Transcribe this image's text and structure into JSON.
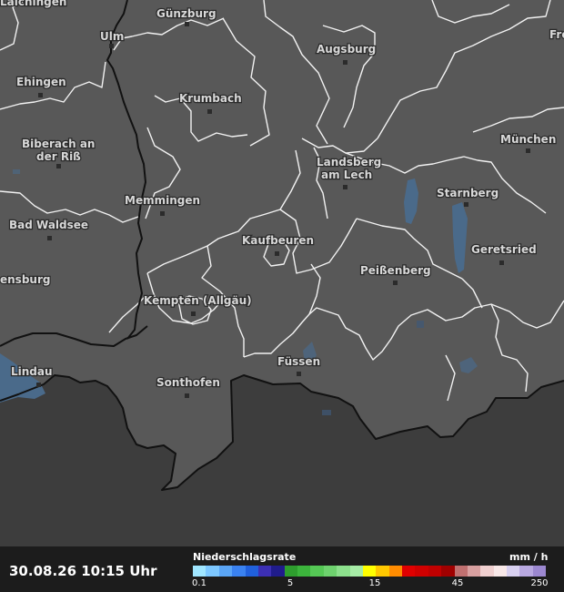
{
  "map": {
    "cities": [
      {
        "id": "laichingen",
        "label": "Laichingen"
      },
      {
        "id": "guenzburg",
        "label": "Günzburg"
      },
      {
        "id": "ulm",
        "label": "Ulm"
      },
      {
        "id": "augsburg",
        "label": "Augsburg"
      },
      {
        "id": "ehingen",
        "label": "Ehingen"
      },
      {
        "id": "krumbach",
        "label": "Krumbach"
      },
      {
        "id": "biberach",
        "label_line1": "Biberach an",
        "label_line2": "der Riß"
      },
      {
        "id": "muenchen",
        "label": "München"
      },
      {
        "id": "landsberg",
        "label_line1": "Landsberg",
        "label_line2": "am Lech"
      },
      {
        "id": "starnberg",
        "label": "Starnberg"
      },
      {
        "id": "memmingen",
        "label": "Memmingen"
      },
      {
        "id": "bad-waldsee",
        "label": "Bad Waldsee"
      },
      {
        "id": "kaufbeuren",
        "label": "Kaufbeuren"
      },
      {
        "id": "geretsried",
        "label": "Geretsried"
      },
      {
        "id": "ravensburg",
        "label": "ensburg"
      },
      {
        "id": "peissenberg",
        "label": "Peißenberg"
      },
      {
        "id": "kempten",
        "label": "Kempten (Allgäu)"
      },
      {
        "id": "lindau",
        "label": "Lindau"
      },
      {
        "id": "fuessen",
        "label": "Füssen"
      },
      {
        "id": "sonthofen",
        "label": "Sonthofen"
      },
      {
        "id": "freising",
        "label": "Fre"
      }
    ]
  },
  "footer": {
    "timestamp": "30.08.26 10:15 Uhr",
    "legend_title": "Niederschlagsrate",
    "legend_unit": "mm / h",
    "legend_ticks": [
      "0.1",
      "5",
      "15",
      "45",
      "250"
    ],
    "legend_colors": [
      "#a0e6ff",
      "#7dc8ff",
      "#5aa5f5",
      "#3a82f0",
      "#2060dc",
      "#3c2fb4",
      "#201c8c",
      "#2e9e2e",
      "#3cb43c",
      "#55c855",
      "#6ed26e",
      "#8ce08c",
      "#a6eca6",
      "#ffff00",
      "#ffc800",
      "#ff8c00",
      "#e00000",
      "#d00000",
      "#c00000",
      "#a00000",
      "#c07070",
      "#d8a0a0",
      "#f0d0d0",
      "#f8e8e8",
      "#d8d0f0",
      "#b8a8e0",
      "#9c88d0"
    ]
  }
}
